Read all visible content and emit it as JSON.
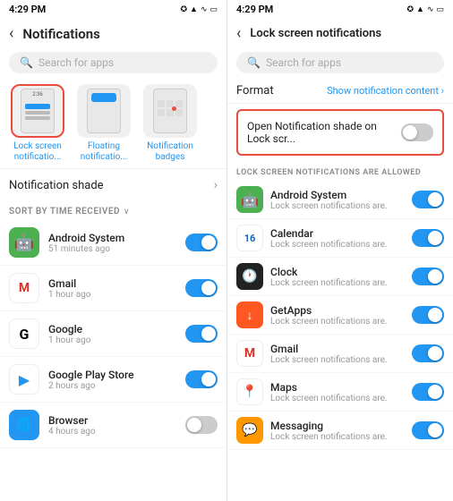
{
  "left": {
    "statusBar": {
      "time": "4:29 PM",
      "icons": "bluetooth signal wifi battery"
    },
    "header": {
      "title": "Notifications",
      "backLabel": "‹"
    },
    "search": {
      "placeholder": "Search for apps"
    },
    "notifTypes": [
      {
        "id": "lock",
        "label": "Lock screen\nnotificatio...",
        "selected": true
      },
      {
        "id": "floating",
        "label": "Floating\nnotificatio..."
      },
      {
        "id": "badges",
        "label": "Notification\nbadges"
      }
    ],
    "sections": [
      {
        "label": "Notification shade",
        "hasChevron": true
      }
    ],
    "sortBar": {
      "label": "SORT BY TIME RECEIVED"
    },
    "apps": [
      {
        "name": "Android System",
        "time": "51 minutes ago",
        "toggleOn": true,
        "icon": "🤖",
        "iconClass": "icon-android"
      },
      {
        "name": "Gmail",
        "time": "1 hour ago",
        "toggleOn": true,
        "icon": "M",
        "iconClass": "icon-gmail"
      },
      {
        "name": "Google",
        "time": "1 hour ago",
        "toggleOn": true,
        "icon": "G",
        "iconClass": "icon-google"
      },
      {
        "name": "Google Play Store",
        "time": "2 hours ago",
        "toggleOn": true,
        "icon": "▶",
        "iconClass": "icon-play"
      },
      {
        "name": "Browser",
        "time": "4 hours ago",
        "toggleOn": false,
        "icon": "🌐",
        "iconClass": "icon-browser"
      }
    ]
  },
  "right": {
    "statusBar": {
      "time": "4:29 PM"
    },
    "header": {
      "title": "Lock screen notifications",
      "backLabel": "‹"
    },
    "search": {
      "placeholder": "Search for apps"
    },
    "format": {
      "label": "Format",
      "link": "Show notification content ›"
    },
    "openNotif": {
      "label": "Open Notification shade on Lock scr..."
    },
    "allowedHeader": "LOCK SCREEN NOTIFICATIONS ARE ALLOWED",
    "apps": [
      {
        "name": "Android System",
        "sub": "Lock screen notifications are.",
        "toggleOn": true,
        "icon": "🤖",
        "iconClass": "icon-android"
      },
      {
        "name": "Calendar",
        "sub": "Lock screen notifications are.",
        "toggleOn": true,
        "icon": "16",
        "iconClass": "icon-calendar"
      },
      {
        "name": "Clock",
        "sub": "Lock screen notifications are.",
        "toggleOn": true,
        "icon": "🕐",
        "iconClass": "icon-clock"
      },
      {
        "name": "GetApps",
        "sub": "Lock screen notifications are.",
        "toggleOn": true,
        "icon": "↓",
        "iconClass": "icon-getapps"
      },
      {
        "name": "Gmail",
        "sub": "Lock screen notifications are.",
        "toggleOn": true,
        "icon": "M",
        "iconClass": "icon-gmail"
      },
      {
        "name": "Maps",
        "sub": "Lock screen notifications are.",
        "toggleOn": true,
        "icon": "📍",
        "iconClass": "icon-maps"
      },
      {
        "name": "Messaging",
        "sub": "Lock screen notifications are.",
        "toggleOn": true,
        "icon": "💬",
        "iconClass": "icon-messaging"
      }
    ]
  }
}
